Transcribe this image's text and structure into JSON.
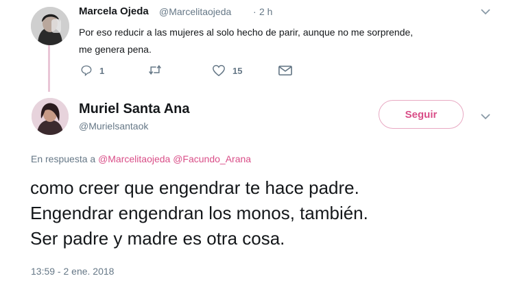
{
  "reply_tweet": {
    "author_name": "Marcela Ojeda",
    "handle": "@Marcelitaojeda",
    "separator": "·",
    "time": "2 h",
    "text_line1": "Por eso reducir a las mujeres al solo hecho de parir, aunque no me sorprende,",
    "text_line2": "me genera pena.",
    "actions": {
      "reply_count": "1",
      "retweet_count": "",
      "like_count": "15"
    }
  },
  "main_tweet": {
    "author_name": "Muriel Santa Ana",
    "handle": "@Murielsantaok",
    "follow_label": "Seguir",
    "reply_prefix": "En respuesta a",
    "mention_1": "@Marcelitaojeda",
    "mention_2": "@Facundo_Arana",
    "text_line1": "como creer que engendrar te hace padre.",
    "text_line2": "Engendrar engendran los monos, también.",
    "text_line3": "Ser padre y madre es otra cosa.",
    "timestamp": "13:59 - 2 ene. 2018"
  },
  "colors": {
    "accent": "#d94d87",
    "thread_line": "#e9c6d6",
    "secondary_text": "#657786"
  },
  "icons": [
    "reply-icon",
    "retweet-icon",
    "like-icon",
    "direct-message-icon",
    "chevron-down-icon"
  ]
}
